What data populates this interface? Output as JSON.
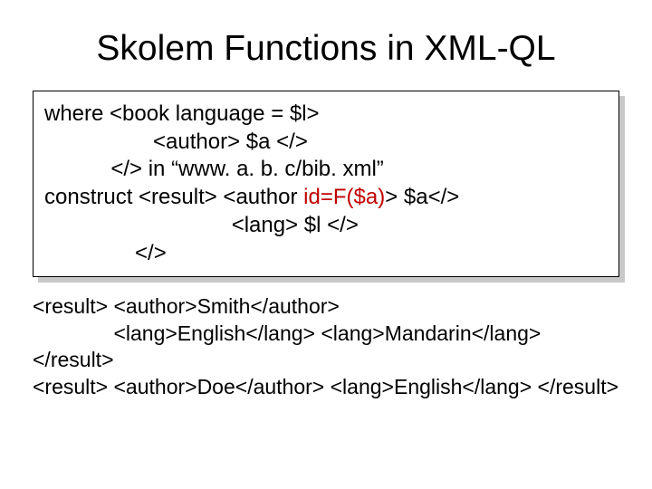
{
  "title": "Skolem Functions in XML-QL",
  "code": {
    "l1a": "where <book language = $l>",
    "l2": "                  <author> $a </>",
    "l3": "           </> in “www. a. b. c/bib. xml”",
    "l4a": "construct <result> <author ",
    "l4b": "id=F($a)",
    "l4c": "> $a</>",
    "l5": "                               <lang> $l </>",
    "l6": "               </>"
  },
  "out": {
    "l1": "<result> <author>Smith</author>",
    "l2": "              <lang>English</lang> <lang>Mandarin</lang>",
    "l3": "</result>",
    "l4": "<result> <author>Doe</author> <lang>English</lang> </result>"
  }
}
